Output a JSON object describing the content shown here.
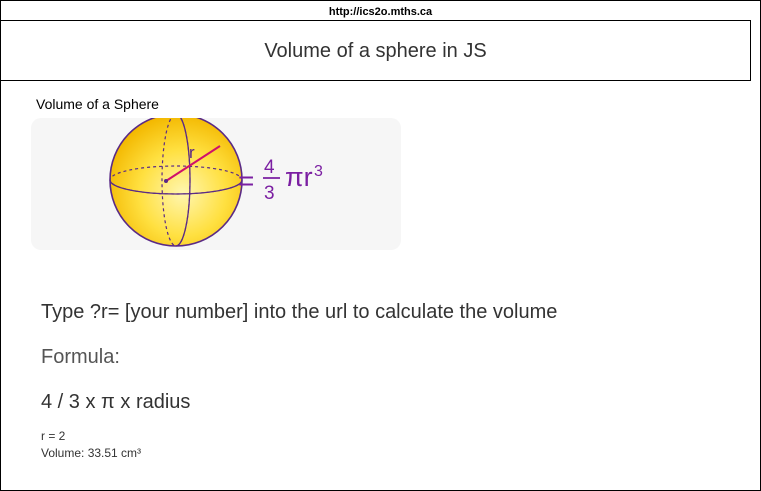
{
  "browser": {
    "url": "http://ics2o.mths.ca"
  },
  "header": {
    "title": "Volume of a sphere in JS"
  },
  "figure": {
    "caption": "Volume of a Sphere",
    "radius_label": "r",
    "equals": "=",
    "numerator": "4",
    "denominator": "3",
    "pi_r": "πr",
    "exponent": "3",
    "colors": {
      "sphere_fill": "#ffd21a",
      "outline": "#5a2a86",
      "radius_line": "#d0106a",
      "formula_text": "#7b1fa2"
    }
  },
  "main": {
    "instructions": "Type ?r= [your number] into the url to calculate the volume",
    "formula_heading": "Formula:",
    "formula_text": "4 / 3 x π x radius",
    "radius_output": "r = 2",
    "volume_output": "Volume: 33.51 cm³"
  }
}
